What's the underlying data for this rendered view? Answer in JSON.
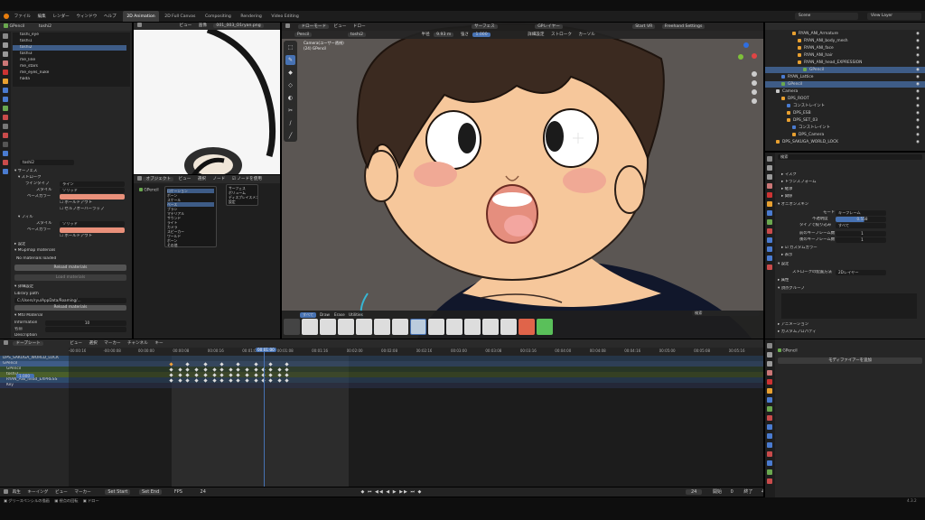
{
  "menu": [
    "ファイル",
    "編集",
    "レンダー",
    "ウィンドウ",
    "ヘルプ"
  ],
  "workspaces": [
    {
      "label": "2D Animation",
      "active": true
    },
    {
      "label": "2D Full Canvas",
      "active": false
    },
    {
      "label": "Compositing",
      "active": false
    },
    {
      "label": "Rendering",
      "active": false
    },
    {
      "label": "Video Editing",
      "active": false
    }
  ],
  "scene": "Scene",
  "view_layer": "View Layer",
  "left_panel": {
    "object": "GPencil",
    "layer": "toshi2",
    "layers": [
      "toshi_eye",
      "toshi1",
      "toshi2",
      "toshi3",
      "me_line",
      "me_stars",
      "me_eyes_nuke",
      "hada"
    ],
    "selected_layer": "toshi2",
    "layer_name_field": "toshi2",
    "section_surface": "サーフェス",
    "section_stroke": "ストローク",
    "line_type_label": "ラインタイプ",
    "line_type": "ライン",
    "style_label": "スタイル",
    "style": "ソリッド",
    "base_color_label": "ベースカラー",
    "holdout": "ホールドアウト",
    "self_overlap": "セルフオーバーラップ",
    "section_fill": "フィル",
    "fill_style": "ソリッド",
    "fill_base_color_label": "ベースカラー",
    "fill_holdout": "ホールドアウト",
    "section_settings": "設定",
    "section_gpmap": "MGpmap materials",
    "no_materials": "No materials loaded",
    "reload_btn": "Reload materials",
    "load_btn": "Load materials",
    "section_palette": "詳細設定",
    "library_path_label": "Library path",
    "library_path": "C:/Users/ryu/AppData/Roaming/...",
    "reload_library": "Reload materials",
    "section_material": "Mt0 Material",
    "info_label": "Information",
    "info_value": "10",
    "name_label": "名前",
    "desc_label": "Description"
  },
  "image_editor": {
    "menus": [
      "ビュー",
      "画像"
    ],
    "image_name": "001_003_O1ryan.png"
  },
  "gp_editor": {
    "mode": "オブジェクト",
    "menus": [
      "ビュー",
      "選択",
      "ノード"
    ],
    "checkbox_label": "ノードを使用",
    "object": "GPencil",
    "dropdown_items": [
      "ロケーション",
      "ボーン",
      "スケール",
      "ベース",
      "ブラシ",
      "マテリアル",
      "サウンド",
      "ライト",
      "カメラ",
      "スピーカー",
      "ワールド",
      "ボーン",
      "その他"
    ],
    "dropdown2_items": [
      "サーフェス",
      "ボリューム",
      "ディスプレイスメント",
      "設定"
    ]
  },
  "viewport": {
    "object_selector": "Pencil",
    "mode": "ドローモード",
    "menus": [
      "ビュー",
      "ドロー"
    ],
    "layer": "toshi2",
    "radius_label": "半径",
    "radius_value": "9.93 m",
    "strength_label": "強さ",
    "strength_value": "1.000",
    "surface": "サーフェス",
    "gp_layer": "GPレイヤー",
    "advanced": "詳細設定",
    "stroke": "ストローク",
    "cursor": "カーソル",
    "start_vr": "Start VR",
    "freehand": "Freehand Settings",
    "overlay_line1": "Camera(ユーザー透視)",
    "overlay_line2": "(24) GPencil",
    "brush_tabs": [
      "すべて",
      "Draw",
      "Erase",
      "Utilities"
    ],
    "search_placeholder": "検索"
  },
  "outliner": {
    "items": [
      {
        "label": "RYAN_ANI_Armature",
        "indent": 5
      },
      {
        "label": "RYAN_ANI_body_mesh",
        "indent": 6
      },
      {
        "label": "RYAN_ANI_face",
        "indent": 6
      },
      {
        "label": "RYAN_ANI_hair",
        "indent": 6
      },
      {
        "label": "RYAN_ANI_head_EXPRESSION",
        "indent": 6
      },
      {
        "label": "GPencil",
        "indent": 7
      },
      {
        "label": "RYAN_Lattice",
        "indent": 3
      },
      {
        "label": "GPencil",
        "indent": 3
      },
      {
        "label": "Camera",
        "indent": 2
      },
      {
        "label": "DPS_ROOT",
        "indent": 3
      },
      {
        "label": "コンストレイント",
        "indent": 4
      },
      {
        "label": "DPS_ESB",
        "indent": 4
      },
      {
        "label": "DPS_SET_03",
        "indent": 4
      },
      {
        "label": "コンストレイント",
        "indent": 5
      },
      {
        "label": "DPS_Camera",
        "indent": 5
      },
      {
        "label": "DPS_SAKUGA_WORLD_LOCK",
        "indent": 2
      }
    ],
    "selected": [
      5,
      7
    ]
  },
  "properties": {
    "search_placeholder": "検索",
    "panels": [
      "マスク",
      "トランスフォーム",
      "継承",
      "関係"
    ],
    "onion_header": "オニオンスキン",
    "onion_mode_label": "モード",
    "onion_mode": "キーフレーム",
    "opacity_label": "不透明度",
    "opacity": "0.558",
    "filter_label": "タイプで絞り込み",
    "filter": "すべて",
    "before_label": "前のキーフレーム数",
    "before": "1",
    "after_label": "後のキーフレーム数",
    "after": "1",
    "custom_colors": "カスタムカラー",
    "display": "表示",
    "settings_header": "設定",
    "stroke_depth_label": "ストロークの配置方法",
    "stroke_depth": "2Dレイヤー",
    "attributes": "属性",
    "vertex_groups": "頂点グループ",
    "animation": "アニメーション",
    "custom_props": "カスタムプロパティ"
  },
  "dopesheet": {
    "mode": "ドープシート",
    "menus": [
      "ビュー",
      "選択",
      "マーカー",
      "チャンネル",
      "キー"
    ],
    "current_frame": "00:01:00",
    "timecodes": [
      "-00:00:16",
      "-00:00:08",
      "00:00:00",
      "00:00:08",
      "00:00:16",
      "00:01:00",
      "00:01:08",
      "00:01:16",
      "00:02:00",
      "00:02:08",
      "00:02:16",
      "00:03:00",
      "00:03:08",
      "00:03:16",
      "00:04:00",
      "00:04:08",
      "00:04:16",
      "00:05:00",
      "00:05:08",
      "00:05:16"
    ],
    "channels": [
      {
        "label": "DPS_SAKUGA_WORLD_LOCK",
        "color": "#2e4a6b"
      },
      {
        "label": "GPencil",
        "color": "#3e5c87"
      },
      {
        "label": "GPencil",
        "color": "#324a2e"
      },
      {
        "label": "toshi2",
        "color": "#4a5f2a"
      },
      {
        "label": "RYAN_ANI_head_EXPRESS",
        "color": "#2e4a6b"
      },
      {
        "label": "Key",
        "color": "#2b3350"
      }
    ],
    "opacity_value": "1.000"
  },
  "modifier_panel": {
    "object": "GPencil",
    "add_modifier": "モディファイアーを追加"
  },
  "timeline": {
    "menus": [
      "再生",
      "キーイング",
      "ビュー",
      "マーカー"
    ],
    "set_start": "Set Start",
    "set_end": "Set End",
    "fps_label": "FPS",
    "fps": "24",
    "current": "24",
    "start_label": "開始",
    "start": "0",
    "end_label": "終了",
    "end": "48"
  },
  "statusbar": {
    "items": [
      "グリースペンシルの描画",
      "視点の回転",
      "ドロー"
    ],
    "version": "4.3.2"
  }
}
